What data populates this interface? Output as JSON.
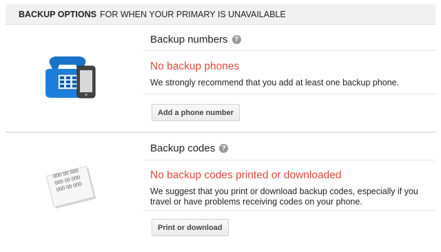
{
  "header": {
    "strong": "BACKUP OPTIONS",
    "rest": "FOR WHEN YOUR PRIMARY IS UNAVAILABLE"
  },
  "backup_numbers": {
    "title": "Backup numbers",
    "help_glyph": "?",
    "status": "No backup phones",
    "description": "We strongly recommend that you add at least one backup phone.",
    "button": "Add a phone number",
    "icon": "phone-icon"
  },
  "backup_codes": {
    "title": "Backup codes",
    "help_glyph": "?",
    "status": "No backup codes printed or downloaded",
    "description": "We suggest that you print or download backup codes, especially if you travel or have problems receiving codes on your phone.",
    "button": "Print or download",
    "icon": "codes-paper-icon",
    "code_lines": [
      "000 00 000",
      "000 00 000",
      "000 00 000"
    ]
  },
  "colors": {
    "warning": "#dd4b39",
    "phone_blue": "#1a73c8",
    "header_bg": "#f1f1f1"
  }
}
